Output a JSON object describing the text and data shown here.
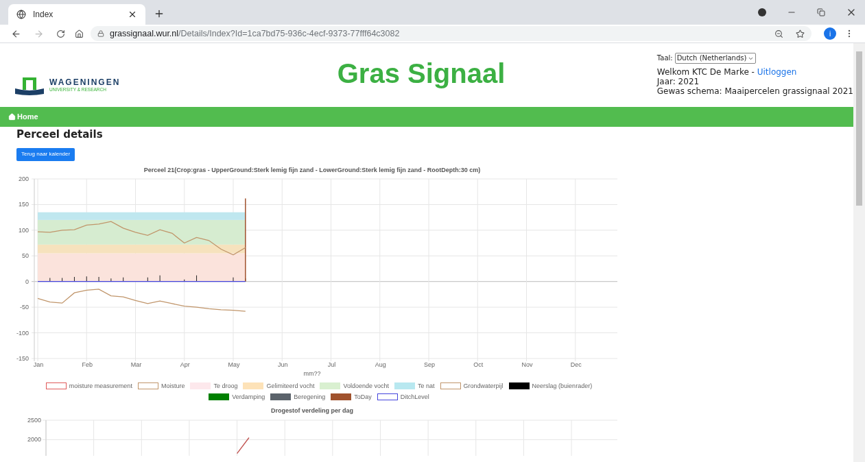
{
  "browser": {
    "tab_title": "Index",
    "url_host": "grassignaal.wur.nl",
    "url_path": "/Details/Index?Id=1ca7bd75-936c-4ecf-9373-77fff64c3082",
    "profile_initial": "i"
  },
  "header": {
    "logo_name": "WAGENINGEN",
    "logo_sub": "UNIVERSITY & RESEARCH",
    "title": "Gras Signaal",
    "language_label": "Taal:",
    "language_value": "Dutch (Netherlands)",
    "welcome": "Welkom KTC De Marke - ",
    "logout": "Uitloggen",
    "year": "Jaar: 2021",
    "scheme": "Gewas schema: Maaipercelen grassignaal 2021"
  },
  "nav": {
    "home": "Home"
  },
  "page": {
    "heading": "Perceel details",
    "back_button": "Terug naar kalender"
  },
  "charts": [
    {
      "chart_data": {
        "type": "line",
        "title": "Perceel 21(Crop:gras - UpperGround:Sterk lemig fijn zand - LowerGround:Sterk lemig fijn zand - RootDepth:30 cm)",
        "xlabel": "mm??",
        "ylim": [
          -150,
          200
        ],
        "yticks": [
          200,
          150,
          100,
          50,
          0,
          -50,
          -100,
          -150
        ],
        "categories": [
          "Jan",
          null,
          null,
          null,
          "Feb",
          null,
          null,
          null,
          "Mar",
          null,
          null,
          null,
          "Apr",
          null,
          null,
          null,
          "May",
          null,
          null,
          null,
          "Jun",
          null,
          null,
          null,
          "Jul",
          null,
          null,
          null,
          "Aug",
          null,
          null,
          null,
          "Sep",
          null,
          null,
          null,
          "Oct",
          null,
          null,
          null,
          "Nov",
          null,
          null,
          null,
          "Dec",
          null,
          null,
          null
        ],
        "series": [
          {
            "color": "#c0956a",
            "values": [
              97,
              96,
              100,
              101,
              110,
              112,
              117,
              104,
              96,
              90,
              101,
              94,
              75,
              86,
              80,
              63,
              52,
              66,
              null,
              null,
              null,
              null,
              null,
              null,
              null,
              null,
              null,
              null,
              null,
              null,
              null,
              null,
              null,
              null,
              null,
              null,
              null,
              null,
              null,
              null,
              null,
              null,
              null,
              null,
              null,
              null,
              null,
              null
            ]
          },
          {
            "color": "#c0956a",
            "values": [
              -33,
              -40,
              -42,
              -22,
              -17,
              -15,
              -28,
              -30,
              -37,
              -43,
              -38,
              -43,
              -48,
              -50,
              -53,
              -55,
              -56,
              -58,
              null,
              null,
              null,
              null,
              null,
              null,
              null,
              null,
              null,
              null,
              null,
              null,
              null,
              null,
              null,
              null,
              null,
              null,
              null,
              null,
              null,
              null,
              null,
              null,
              null,
              null,
              null,
              null,
              null,
              null
            ]
          },
          {
            "color": "#4444dd",
            "values": [
              0,
              0,
              0,
              0,
              0,
              0,
              0,
              0,
              0,
              0,
              0,
              0,
              0,
              0,
              0,
              0,
              0,
              0,
              null,
              null,
              null,
              null,
              null,
              null,
              null,
              null,
              null,
              null,
              null,
              null,
              null,
              null,
              null,
              null,
              null,
              null,
              null,
              null,
              null,
              null,
              null,
              null,
              null,
              null,
              null,
              null,
              null,
              null
            ]
          }
        ],
        "grid": true,
        "bands": [
          {
            "axis": "y",
            "from": 0,
            "to": 55,
            "color": "#fbe3dc"
          },
          {
            "axis": "y",
            "from": 55,
            "to": 72,
            "color": "#f6e2bd"
          },
          {
            "axis": "y",
            "from": 72,
            "to": 120,
            "color": "#d6ecd0"
          },
          {
            "axis": "y",
            "from": 120,
            "to": 135,
            "color": "#bfe7ef"
          }
        ]
      },
      "legend": [
        {
          "label": "moisture measurement",
          "color": "#e05a5a",
          "kind": "outline"
        },
        {
          "label": "Moisture",
          "color": "#c0956a",
          "kind": "outline"
        },
        {
          "label": "Te droog",
          "color": "#fde8ec",
          "kind": "filled"
        },
        {
          "label": "Gelimiteerd vocht",
          "color": "#fde2b8",
          "kind": "filled"
        },
        {
          "label": "Voldoende vocht",
          "color": "#d9f0d0",
          "kind": "filled"
        },
        {
          "label": "Te nat",
          "color": "#b8e8f0",
          "kind": "filled"
        },
        {
          "label": "Grondwaterpijl",
          "color": "#c0956a",
          "kind": "outline"
        },
        {
          "label": "Neerslag (buienrader)",
          "color": "#000000",
          "kind": "filled"
        },
        {
          "label": "Verdamping",
          "color": "#008000",
          "kind": "filled"
        },
        {
          "label": "Beregening",
          "color": "#5b636b",
          "kind": "filled"
        },
        {
          "label": "ToDay",
          "color": "#a0522d",
          "kind": "filled"
        },
        {
          "label": "DitchLevel",
          "color": "#4444dd",
          "kind": "outline"
        }
      ]
    },
    {
      "chart_data": {
        "type": "line",
        "title": "Drogestof verdeling per dag",
        "ylim": [
          1600,
          2500
        ],
        "grid": true,
        "yticks": [
          2500,
          2000
        ],
        "categories": [
          null,
          null,
          null,
          null,
          null,
          null,
          null,
          null,
          null,
          null,
          null,
          null,
          null,
          null,
          null,
          null,
          null,
          null,
          null,
          null,
          null,
          null,
          null,
          null,
          null,
          null,
          null,
          null,
          null,
          null,
          null,
          null,
          null,
          null,
          null,
          null,
          null,
          null,
          null,
          null,
          null,
          null,
          null,
          null,
          null,
          null,
          null,
          null
        ],
        "series": [
          {
            "color": "#c0504d",
            "values": [
              null,
              null,
              null,
              null,
              null,
              null,
              null,
              null,
              null,
              null,
              null,
              null,
              null,
              null,
              null,
              null,
              1640,
              2050,
              null,
              null,
              null,
              null,
              null,
              null,
              null,
              null,
              null,
              null,
              null,
              null,
              null,
              null,
              null,
              null,
              null,
              null,
              null,
              null,
              null,
              null,
              null,
              null,
              null,
              null,
              null,
              null,
              null,
              null
            ]
          }
        ]
      }
    }
  ]
}
